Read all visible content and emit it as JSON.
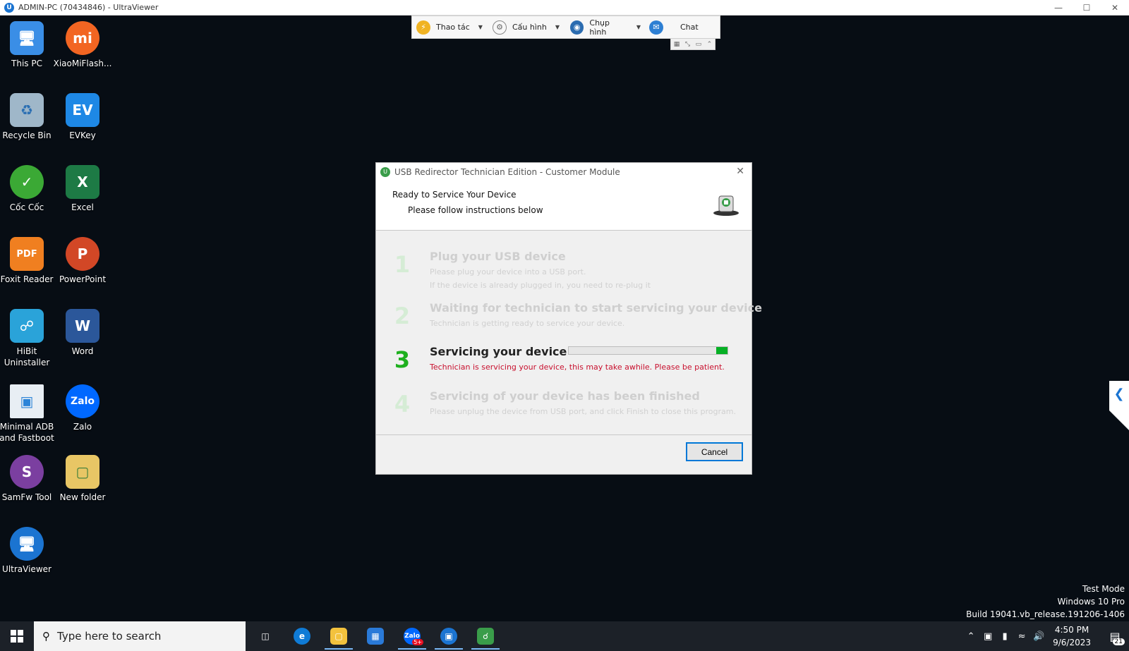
{
  "window": {
    "title": "ADMIN-PC (70434846) - UltraViewer"
  },
  "toolbar": {
    "items": [
      {
        "label": "Thao tác",
        "has_menu": true,
        "icon": "lightning-icon"
      },
      {
        "label": "Cấu hình",
        "has_menu": true,
        "icon": "gear-icon"
      },
      {
        "label": "Chụp hình",
        "has_menu": true,
        "icon": "camera-icon"
      },
      {
        "label": "Chat",
        "has_menu": false,
        "icon": "chat-icon"
      }
    ]
  },
  "desktop": {
    "icons": [
      {
        "label": "This PC",
        "icon": "computer-icon",
        "color": "#3a8ee6"
      },
      {
        "label": "XiaoMiFlash...",
        "icon": "mi-icon",
        "color": "#f26522"
      },
      {
        "label": "Recycle Bin",
        "icon": "recycle-bin-icon",
        "color": "#9fb7c9"
      },
      {
        "label": "EVKey",
        "icon": "evkey-icon",
        "color": "#1e88e5"
      },
      {
        "label": "Cốc Cốc",
        "icon": "coccoc-icon",
        "color": "#3ba935"
      },
      {
        "label": "Excel",
        "icon": "excel-icon",
        "color": "#1d7a45"
      },
      {
        "label": "Foxit Reader",
        "icon": "foxit-icon",
        "color": "#f07f20"
      },
      {
        "label": "PowerPoint",
        "icon": "powerpoint-icon",
        "color": "#d24726"
      },
      {
        "label": "HiBit Uninstaller",
        "icon": "hibit-icon",
        "color": "#2aa3d9"
      },
      {
        "label": "Word",
        "icon": "word-icon",
        "color": "#2b579a"
      },
      {
        "label": "Minimal ADB and Fastboot",
        "icon": "adb-icon",
        "color": "#2c84d8"
      },
      {
        "label": "Zalo",
        "icon": "zalo-icon",
        "color": "#0068ff"
      },
      {
        "label": "SamFw Tool",
        "icon": "samfw-icon",
        "color": "#7b3fa0"
      },
      {
        "label": "New folder",
        "icon": "folder-icon",
        "color": "#e8c665"
      },
      {
        "label": "UltraViewer",
        "icon": "ultraviewer-icon",
        "color": "#1b74d1"
      }
    ]
  },
  "dialog": {
    "title": "USB Redirector Technician Edition - Customer Module",
    "header_title": "Ready to Service Your Device",
    "header_subtitle": "Please follow instructions below",
    "steps": [
      {
        "num": "1",
        "title": "Plug your USB device",
        "lines": [
          "Please plug your device into a USB port.",
          "If the device is already plugged in, you need to re-plug it"
        ],
        "state": "done"
      },
      {
        "num": "2",
        "title": "Waiting for technician to start servicing your device",
        "lines": [
          "Technician is getting ready to service your device."
        ],
        "state": "done"
      },
      {
        "num": "3",
        "title": "Servicing your device",
        "lines": [
          "Technician is servicing your device, this may take awhile. Please be patient."
        ],
        "state": "active",
        "progress": 0.07
      },
      {
        "num": "4",
        "title": "Servicing of your device has been finished",
        "lines": [
          "Please unplug the device from USB port, and click Finish to close this program."
        ],
        "state": "pending"
      }
    ],
    "cancel_label": "Cancel"
  },
  "watermark": {
    "line1": "Test Mode",
    "line2": "Windows 10 Pro",
    "line3": "Build 19041.vb_release.191206-1406"
  },
  "taskbar": {
    "search_placeholder": "Type here to search",
    "apps": [
      {
        "name": "task-view",
        "icon": "task-view-icon",
        "color": "#1c2128"
      },
      {
        "name": "edge",
        "icon": "edge-icon",
        "color": "#0f7bd6"
      },
      {
        "name": "file-explorer",
        "icon": "folder-icon",
        "color": "#f3c23d"
      },
      {
        "name": "store",
        "icon": "store-icon",
        "color": "#2a7ad8"
      },
      {
        "name": "zalo",
        "icon": "zalo-icon",
        "color": "#0068ff",
        "badge": "5+"
      },
      {
        "name": "ultraviewer",
        "icon": "ultraviewer-icon",
        "color": "#1b74d1"
      },
      {
        "name": "usb-redirector",
        "icon": "usb-redirector-icon",
        "color": "#3a9d4a"
      }
    ],
    "time": "4:50 PM",
    "date": "9/6/2023",
    "notification_count": "21"
  }
}
